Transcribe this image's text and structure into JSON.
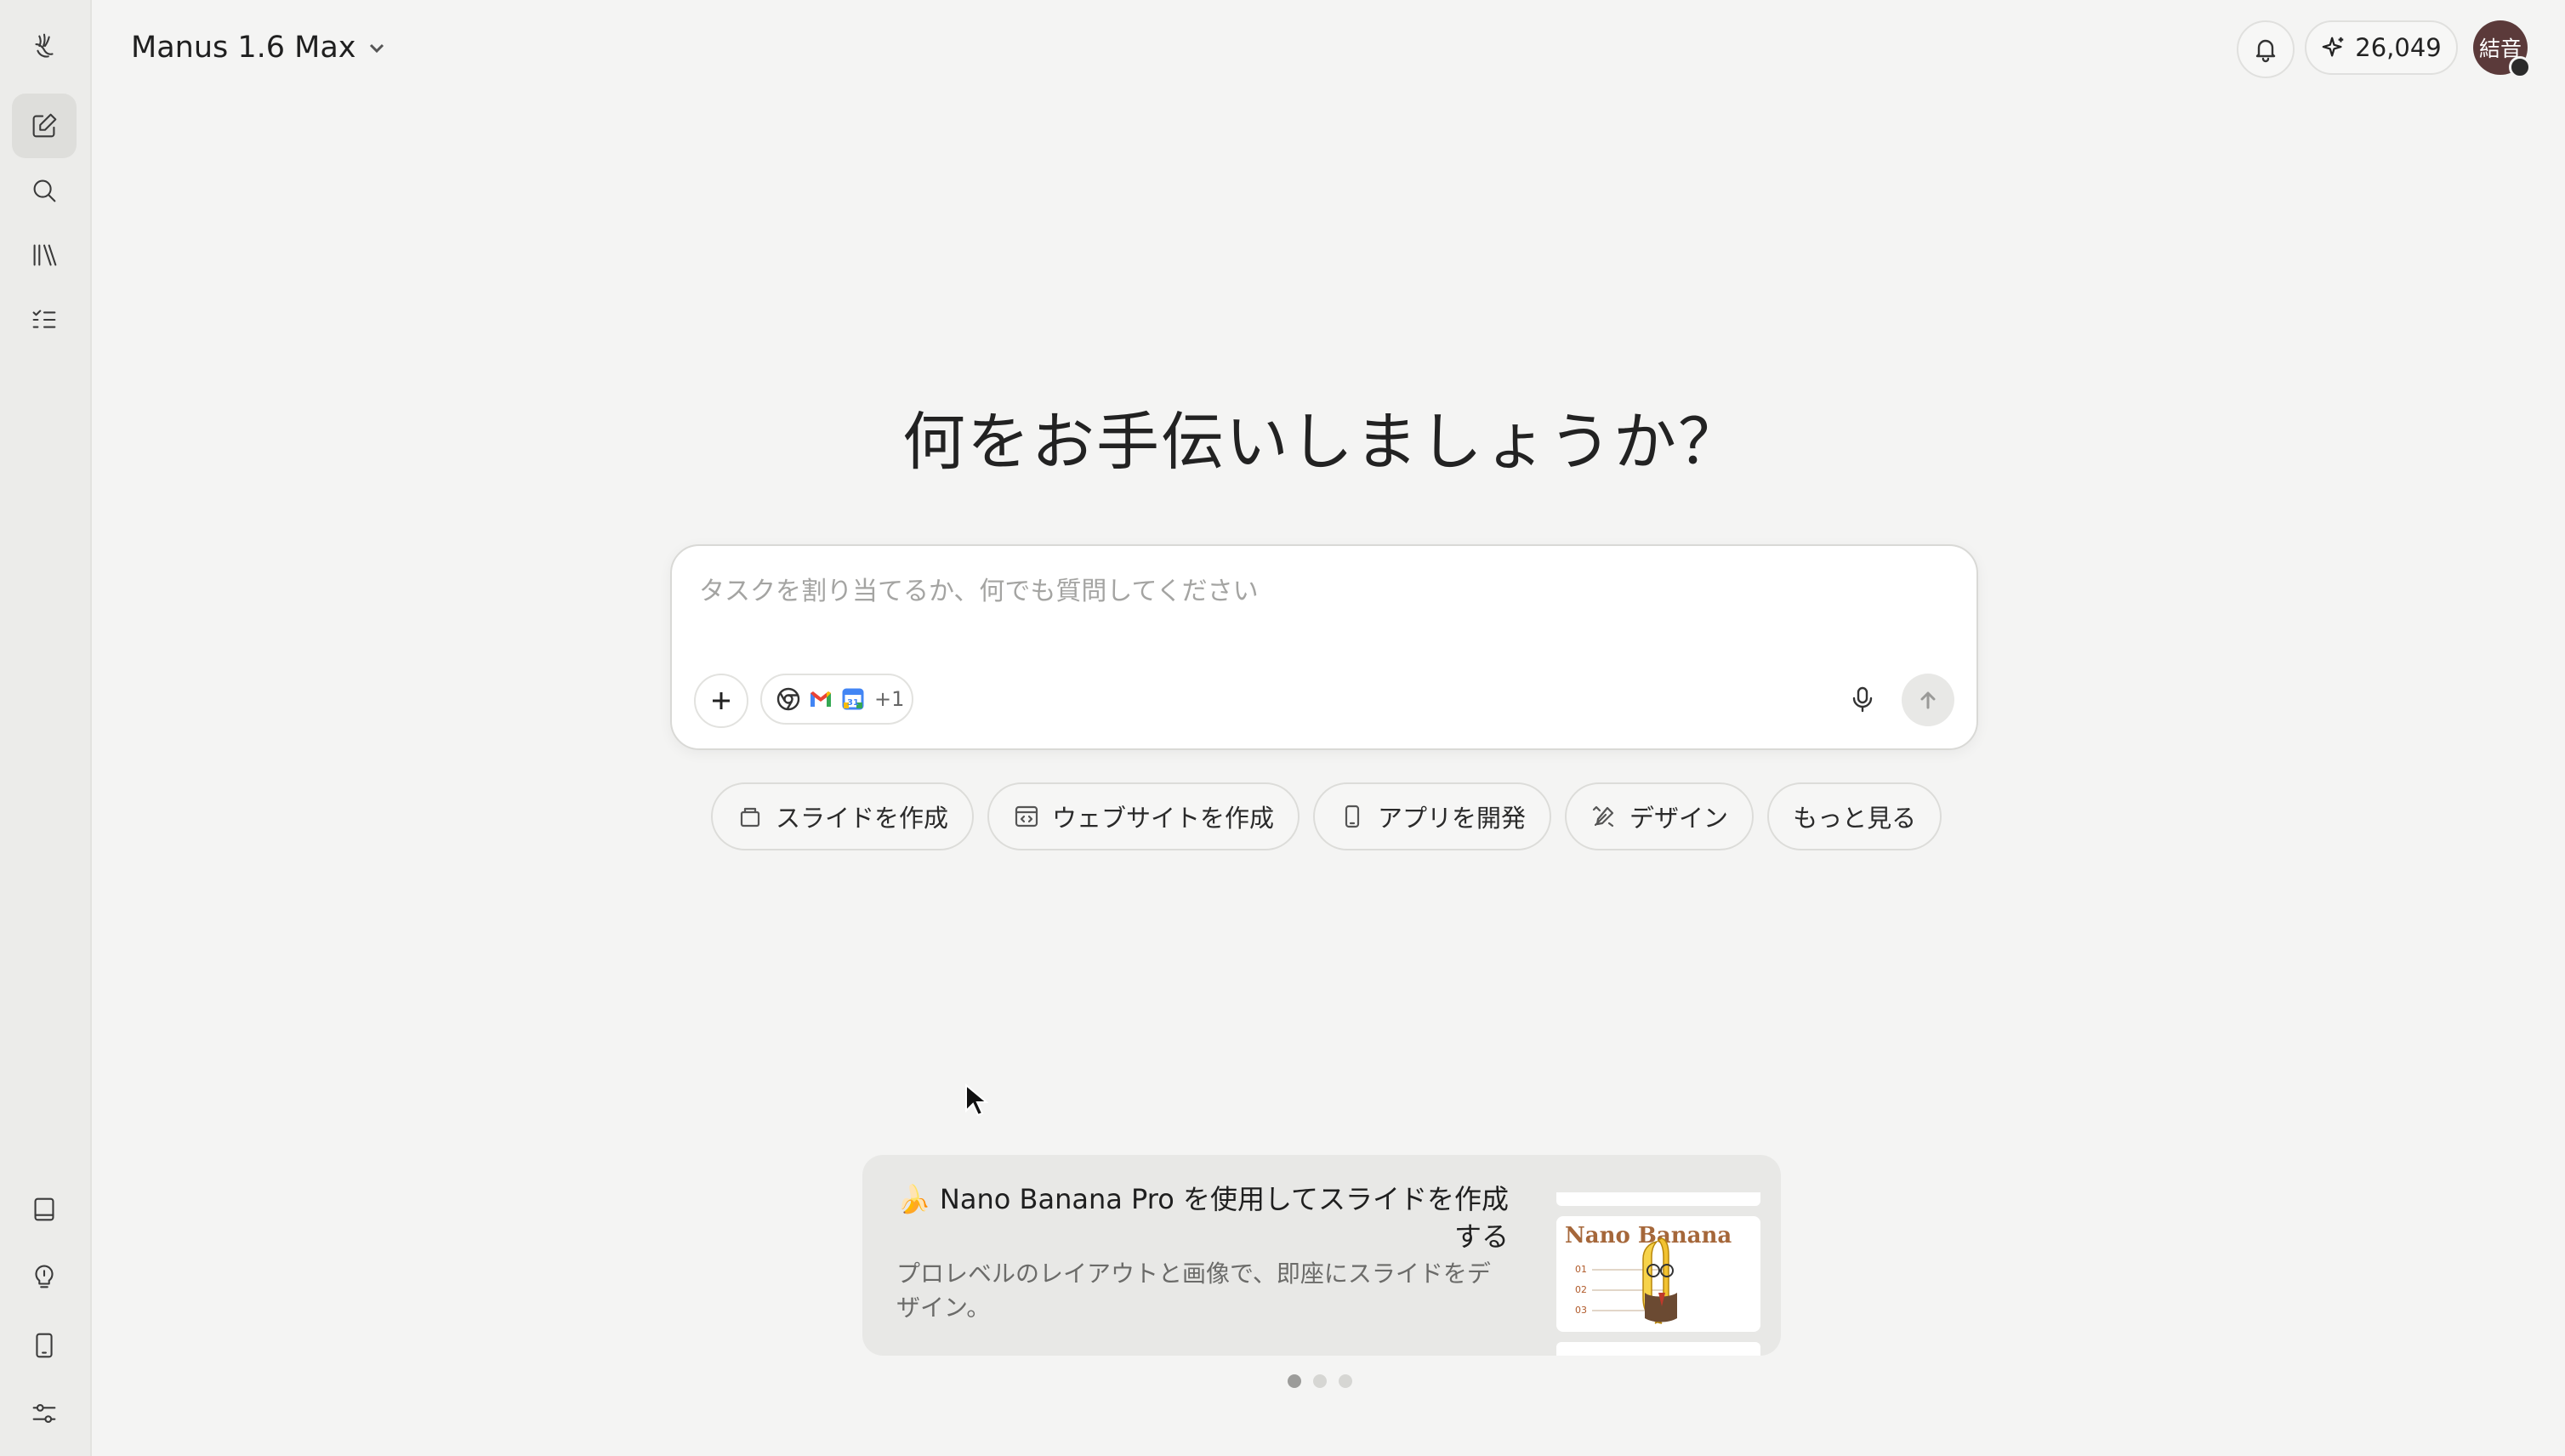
{
  "header": {
    "model_name": "Manus 1.6 Max",
    "credits": "26,049",
    "avatar_text": "結音"
  },
  "sidebar": {
    "items": [
      {
        "name": "logo",
        "icon": "manus-logo-icon"
      },
      {
        "name": "new-task",
        "icon": "edit-icon"
      },
      {
        "name": "search",
        "icon": "search-icon"
      },
      {
        "name": "library",
        "icon": "library-icon"
      },
      {
        "name": "tasks",
        "icon": "task-list-icon"
      }
    ],
    "bottom_items": [
      {
        "name": "docs",
        "icon": "book-icon"
      },
      {
        "name": "tips",
        "icon": "lightbulb-icon"
      },
      {
        "name": "mobile",
        "icon": "phone-icon"
      },
      {
        "name": "settings",
        "icon": "sliders-icon"
      }
    ]
  },
  "main": {
    "heading": "何をお手伝いしましょうか？",
    "composer": {
      "placeholder": "タスクを割り当てるか、何でも質問してください",
      "tools_more": "+1"
    },
    "quick_actions": [
      {
        "label": "スライドを作成",
        "icon": "slides-icon"
      },
      {
        "label": "ウェブサイトを作成",
        "icon": "website-icon"
      },
      {
        "label": "アプリを開発",
        "icon": "phone-icon"
      },
      {
        "label": "デザイン",
        "icon": "design-icon"
      },
      {
        "label": "もっと見る",
        "icon": ""
      }
    ],
    "promo": {
      "title": "🍌 Nano Banana Pro を使用してスライドを作成する",
      "description": "プロレベルのレイアウトと画像で、即座にスライドをデザイン。",
      "thumb_title": "Nano Banana",
      "thumb_numbers": [
        "01",
        "02",
        "03"
      ],
      "pages": 3,
      "active_page": 1
    }
  },
  "colors": {
    "background": "#f4f4f3",
    "sidebar": "#ececea",
    "avatar": "#5b3a3a",
    "accent_banana": "#e8b21c"
  }
}
